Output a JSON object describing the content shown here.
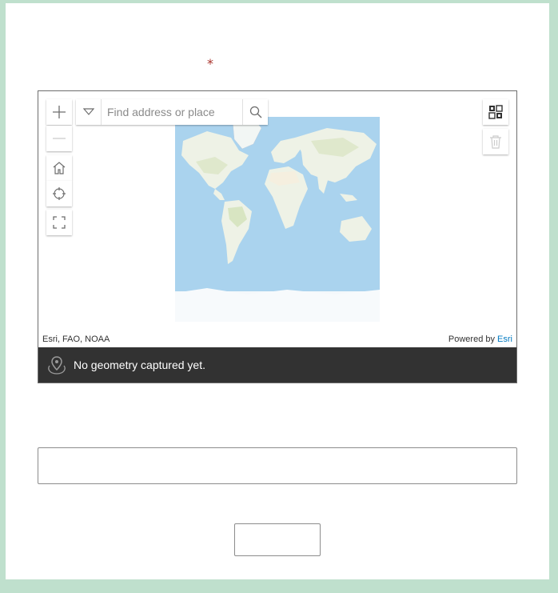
{
  "form": {
    "required_marker": "*"
  },
  "map": {
    "search_placeholder": "Find address or place",
    "attribution_left": "Esri, FAO, NOAA",
    "powered_by": "Powered by",
    "powered_by_brand": "Esri",
    "status_message": "No geometry captured yet.",
    "colors": {
      "ocean": "#aad3ee",
      "land": "#eef2e6",
      "status_bg": "#323232",
      "required": "#a8312a",
      "brand_link": "#0079c1"
    },
    "toolbar_icons": [
      "zoom-in-icon",
      "zoom-out-icon",
      "home-icon",
      "locate-icon",
      "fullscreen-icon",
      "select-icon",
      "trash-icon"
    ]
  },
  "answer": {
    "value": ""
  }
}
